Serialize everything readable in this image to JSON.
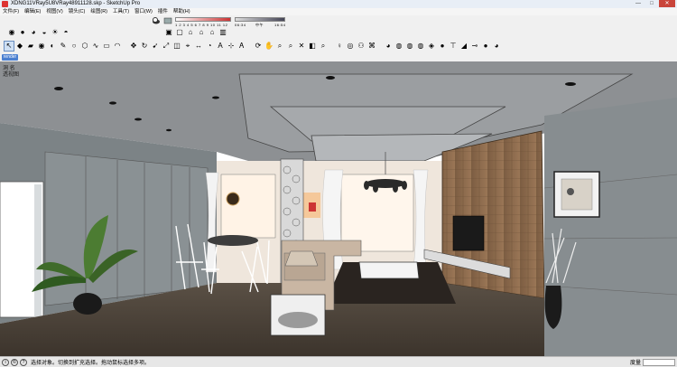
{
  "window": {
    "title": "XDNG11VRay5U8VRay48911128.skp - SketchUp Pro",
    "controls": [
      "—",
      "□",
      "✕"
    ]
  },
  "menus": [
    "文件(F)",
    "编辑(E)",
    "视图(V)",
    "镜头(C)",
    "绘图(R)",
    "工具(T)",
    "窗口(W)",
    "插件",
    "帮助(H)"
  ],
  "shadow_panel": {
    "scale": "1 2 3 4 5 6 7 8 9 10 11 12",
    "time_left": "06:34",
    "time_mid": "中午",
    "time_right": "16:54"
  },
  "scene_tab": "render",
  "viewport": {
    "label_line1": "洞 名",
    "label_line2": "透视图",
    "colors": {
      "ceiling": "#8a8d8f",
      "wall_left": "#7e8487",
      "floor": "#4b4238",
      "wood_wall": "#8a6a4e",
      "window_glow": "#fff3e6"
    }
  },
  "statusbar": {
    "message": "选择对象。切换到扩充选择。拖动鼠标选择多项。",
    "measure_label": "度量"
  }
}
